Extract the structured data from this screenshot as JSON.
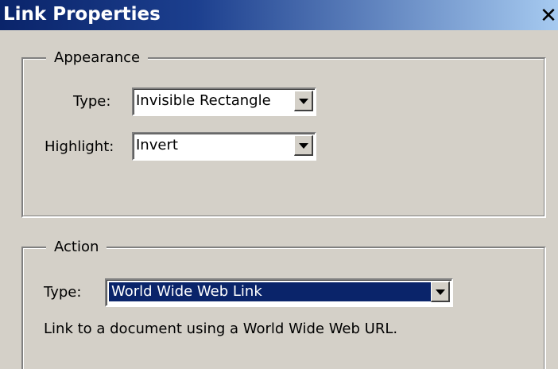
{
  "window": {
    "title": "Link Properties",
    "close_glyph": "✕"
  },
  "appearance": {
    "legend": "Appearance",
    "type_label": "Type:",
    "type_value": "Invisible Rectangle",
    "highlight_label": "Highlight:",
    "highlight_value": "Invert"
  },
  "action": {
    "legend": "Action",
    "type_label": "Type:",
    "type_value": "World Wide Web Link",
    "description": "Link to a document using a World Wide Web URL."
  },
  "colors": {
    "title_bar_start": "#0a246a",
    "title_bar_end": "#a6caf0",
    "dialog_background": "#d4d0c8",
    "selection_background": "#0a246a",
    "selection_text": "#ffffff"
  },
  "icons": {
    "close": "close-icon",
    "dropdown": "chevron-down-icon"
  }
}
